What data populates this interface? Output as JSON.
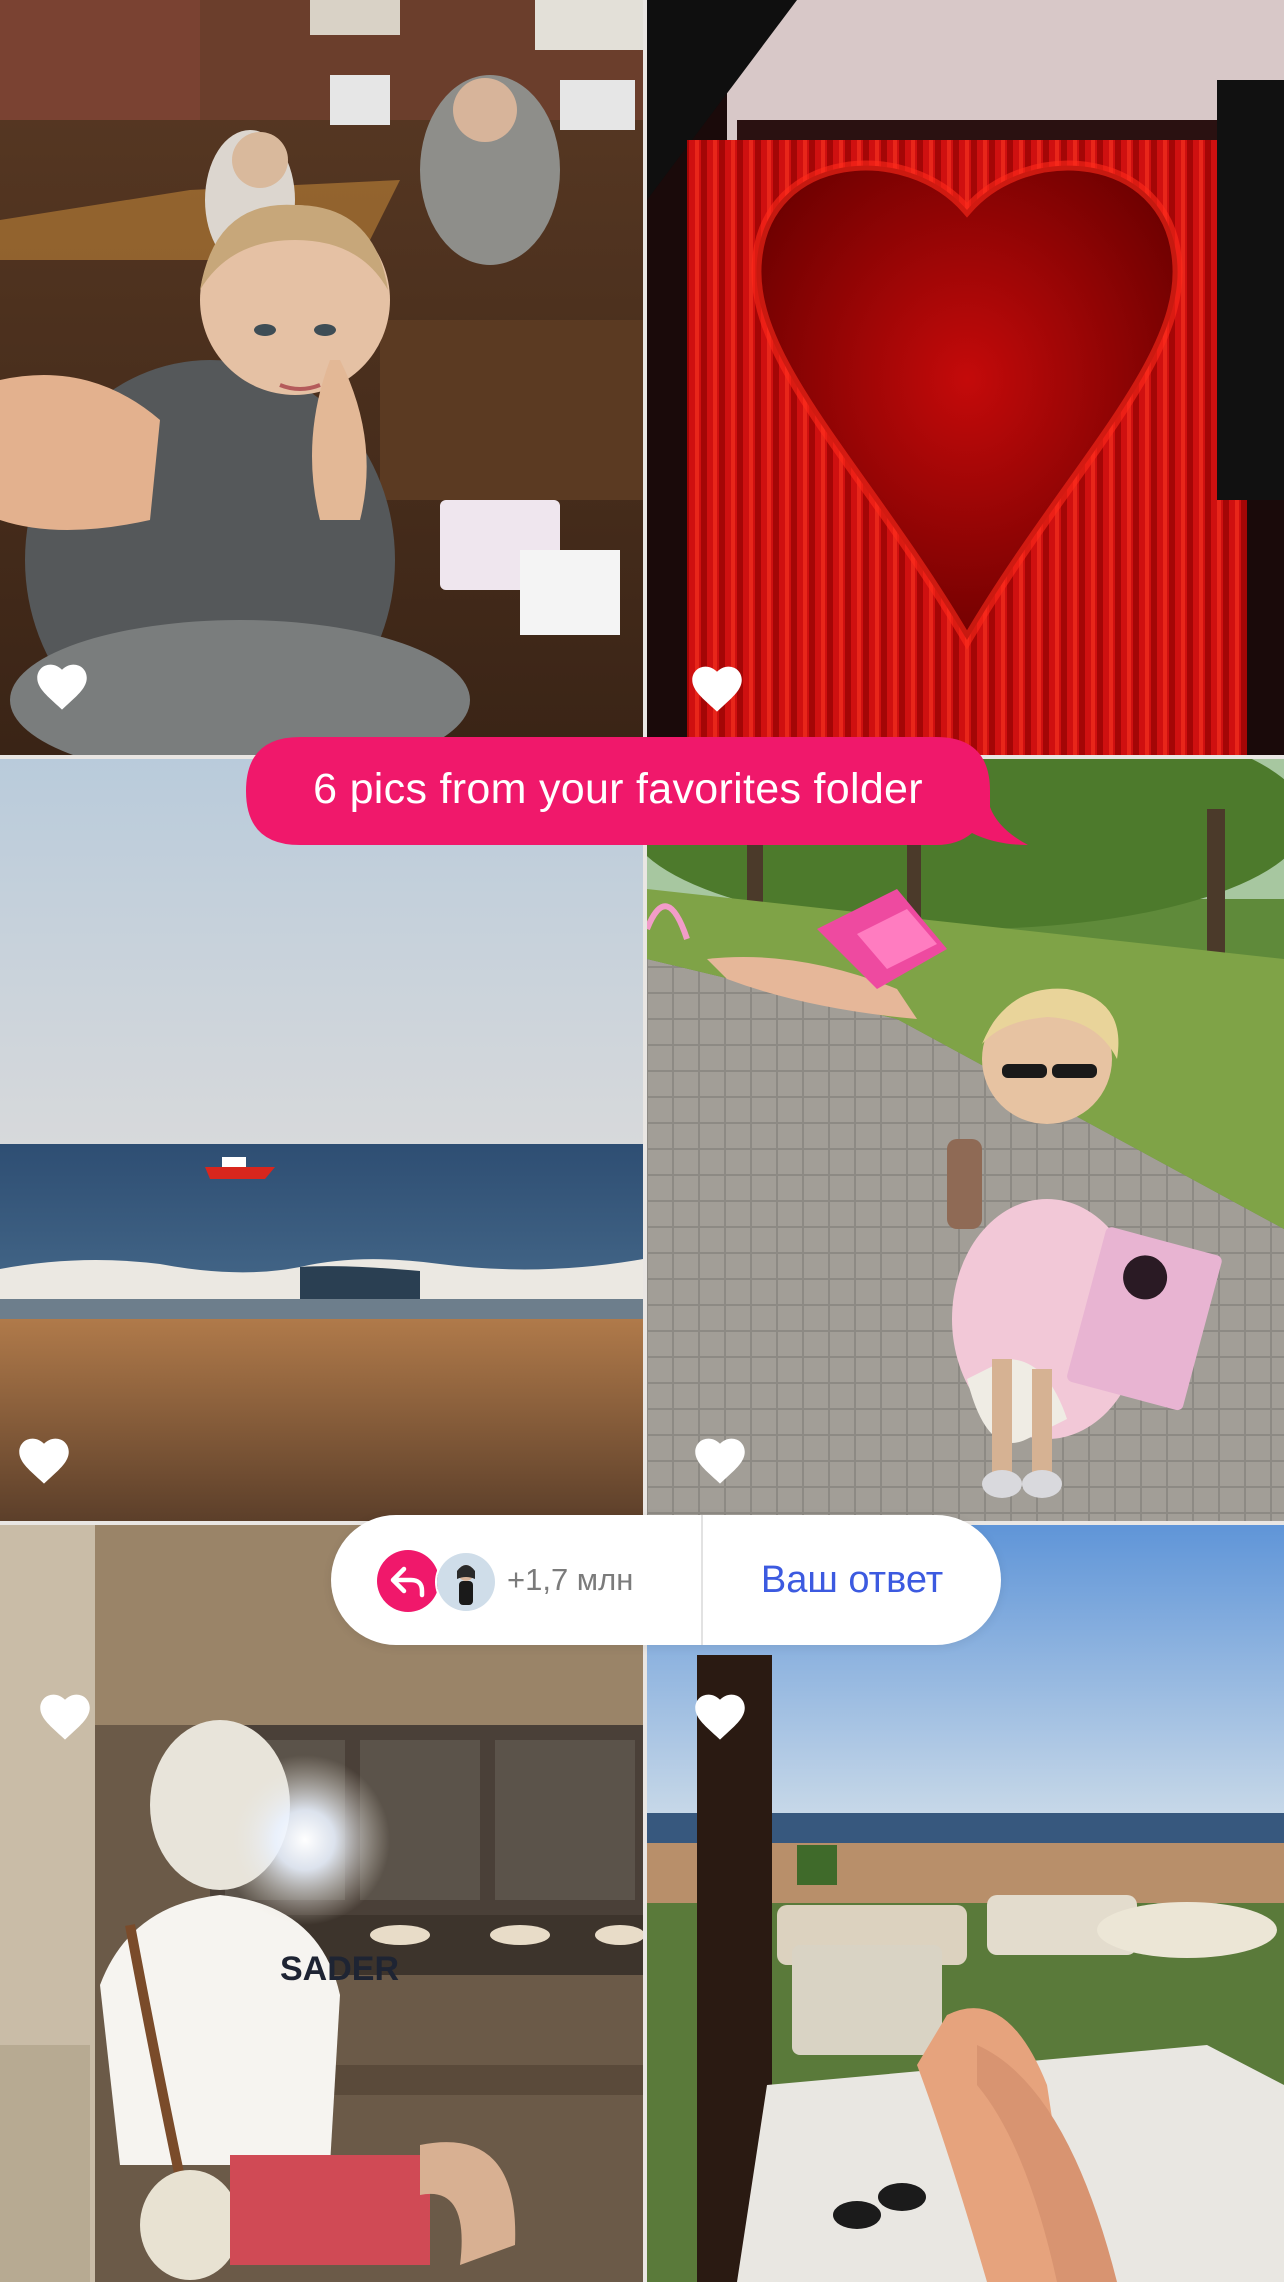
{
  "caption": {
    "text": "6 pics from your favorites folder",
    "bubble_color": "#f0186b"
  },
  "photos": [
    {
      "subject": "girl selfie in studio room",
      "liked": true
    },
    {
      "subject": "red heart-shaped curtain",
      "liked": true
    },
    {
      "subject": "sea beach with red boat",
      "liked": true
    },
    {
      "subject": "girl with pink drink in park",
      "liked": true
    },
    {
      "subject": "mirror selfie with flash",
      "liked": true
    },
    {
      "subject": "beach loungers by the sea",
      "liked": true
    }
  ],
  "icons": {
    "like": "heart-icon",
    "reply": "reply-arrow-icon"
  },
  "reply_bar": {
    "count": "+1,7 млн",
    "answer_label": "Ваш ответ",
    "accent_color": "#3c5ae0"
  }
}
